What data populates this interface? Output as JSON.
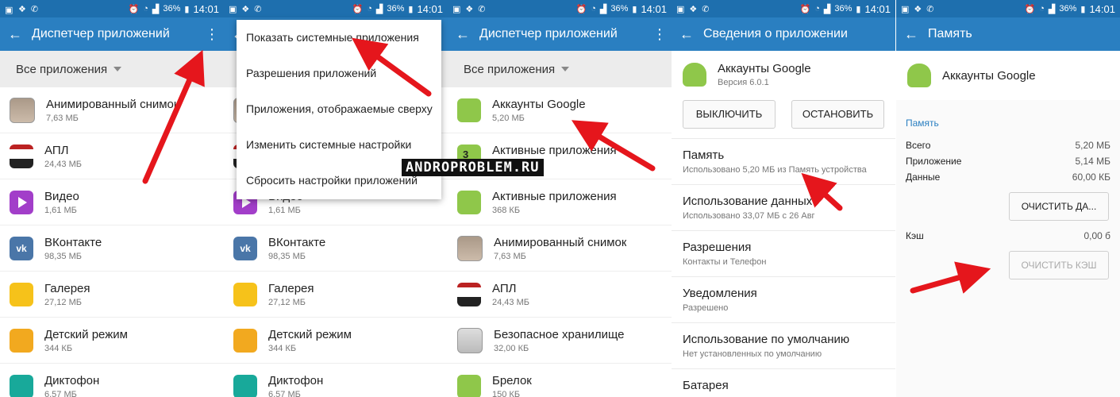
{
  "status": {
    "time": "14:01",
    "battery": "36%"
  },
  "panel1": {
    "title": "Диспетчер приложений",
    "filter": "Все приложения",
    "apps": [
      {
        "name": "Анимированный снимок",
        "size": "7,63 МБ"
      },
      {
        "name": "АПЛ",
        "size": "24,43 МБ"
      },
      {
        "name": "Видео",
        "size": "1,61 МБ"
      },
      {
        "name": "ВКонтакте",
        "size": "98,35 МБ"
      },
      {
        "name": "Галерея",
        "size": "27,12 МБ"
      },
      {
        "name": "Детский режим",
        "size": "344 КБ"
      },
      {
        "name": "Диктофон",
        "size": "6,57 МБ"
      }
    ]
  },
  "panel2": {
    "menu": [
      "Показать системные приложения",
      "Разрешения приложений",
      "Приложения, отображаемые сверху",
      "Изменить системные настройки",
      "Сбросить настройки приложений"
    ],
    "apps": [
      {
        "name": "Видео",
        "size": "1,61 МБ"
      },
      {
        "name": "ВКонтакте",
        "size": "98,35 МБ"
      },
      {
        "name": "Галерея",
        "size": "27,12 МБ"
      },
      {
        "name": "Детский режим",
        "size": "344 КБ"
      },
      {
        "name": "Диктофон",
        "size": "6,57 МБ"
      }
    ]
  },
  "panel3": {
    "title": "Диспетчер приложений",
    "filter": "Все приложения",
    "apps": [
      {
        "name": "Аккаунты Google",
        "size": "5,20 МБ"
      },
      {
        "name": "Активные приложения",
        "size": "1,5 МБ"
      },
      {
        "name": "Активные приложения",
        "size": "368 КБ"
      },
      {
        "name": "Анимированный снимок",
        "size": "7,63 МБ"
      },
      {
        "name": "АПЛ",
        "size": "24,43 МБ"
      },
      {
        "name": "Безопасное хранилище",
        "size": "32,00 КБ"
      },
      {
        "name": "Брелок",
        "size": "150 КБ"
      }
    ]
  },
  "panel4": {
    "title": "Сведения о приложении",
    "app_name": "Аккаунты Google",
    "version": "Версия 6.0.1",
    "disable_label": "ВЫКЛЮЧИТЬ",
    "stop_label": "ОСТАНОВИТЬ",
    "sections": [
      {
        "title": "Память",
        "sub": "Использовано 5,20 МБ из Память устройства"
      },
      {
        "title": "Использование данных",
        "sub": "Использовано 33,07 МБ с 26 Авг"
      },
      {
        "title": "Разрешения",
        "sub": "Контакты и Телефон"
      },
      {
        "title": "Уведомления",
        "sub": "Разрешено"
      },
      {
        "title": "Использование по умолчанию",
        "sub": "Нет установленных по умолчанию"
      },
      {
        "title": "Батарея",
        "sub": ""
      }
    ]
  },
  "panel5": {
    "title": "Память",
    "app_name": "Аккаунты Google",
    "section": "Память",
    "rows": [
      {
        "k": "Всего",
        "v": "5,20 МБ"
      },
      {
        "k": "Приложение",
        "v": "5,14 МБ"
      },
      {
        "k": "Данные",
        "v": "60,00 КБ"
      }
    ],
    "clear_data": "ОЧИСТИТЬ ДА...",
    "cache_label": "Кэш",
    "cache_value": "0,00 б",
    "clear_cache": "ОЧИСТИТЬ КЭШ"
  },
  "watermark": "ANDROPROBLEM.RU",
  "colors": {
    "statusbar": "#1e6fae",
    "appbar": "#2a7fc1",
    "arrow": "#e5161c"
  }
}
